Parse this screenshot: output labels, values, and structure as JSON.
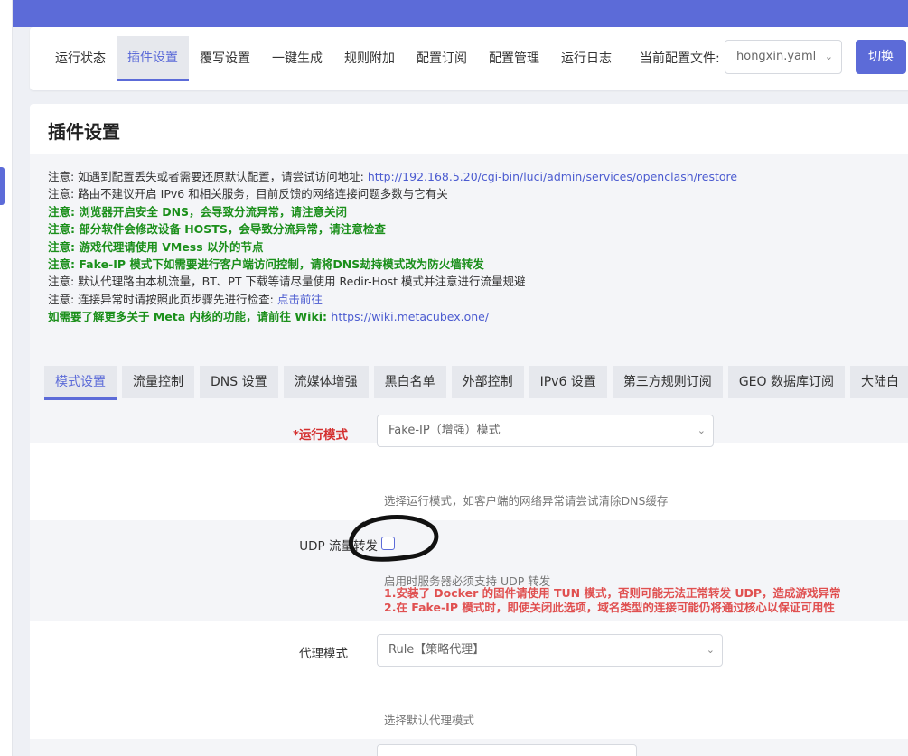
{
  "nav": {
    "tabs": [
      "运行状态",
      "插件设置",
      "覆写设置",
      "一键生成",
      "规则附加",
      "配置订阅",
      "配置管理",
      "运行日志"
    ],
    "active_index": 1,
    "config_label": "当前配置文件:",
    "config_value": "hongxin.yaml",
    "switch_label": "切换"
  },
  "page": {
    "title": "插件设置"
  },
  "notices": [
    {
      "text": "注意: 如遇到配置丢失或者需要还原默认配置，请尝试访问地址: ",
      "link": "http://192.168.5.20/cgi-bin/luci/admin/services/openclash/restore",
      "style": "normal"
    },
    {
      "text": "注意: 路由不建议开启 IPv6 和相关服务，目前反馈的网络连接问题多数与它有关",
      "link": "",
      "style": "normal"
    },
    {
      "text": "注意: 浏览器开启安全 DNS，会导致分流异常，请注意关闭",
      "link": "",
      "style": "green"
    },
    {
      "text": "注意: 部分软件会修改设备 HOSTS，会导致分流异常，请注意检查",
      "link": "",
      "style": "green"
    },
    {
      "text": "注意: 游戏代理请使用 VMess 以外的节点",
      "link": "",
      "style": "green"
    },
    {
      "text": "注意: Fake-IP 模式下如需要进行客户端访问控制，请将DNS劫持模式改为防火墙转发",
      "link": "",
      "style": "green"
    },
    {
      "text": "注意: 默认代理路由本机流量，BT、PT 下载等请尽量使用 Redir-Host 模式并注意进行流量规避",
      "link": "",
      "style": "normal"
    },
    {
      "text": "注意: 连接异常时请按照此页步骤先进行检查: ",
      "link": "点击前往",
      "style": "normal"
    },
    {
      "text": "如需要了解更多关于 Meta 内核的功能，请前往 Wiki: ",
      "link": "https://wiki.metacubex.one/",
      "style": "green"
    }
  ],
  "sub_tabs": [
    "模式设置",
    "流量控制",
    "DNS 设置",
    "流媒体增强",
    "黑白名单",
    "外部控制",
    "IPv6 设置",
    "第三方规则订阅",
    "GEO 数据库订阅",
    "大陆白"
  ],
  "sub_active_index": 0,
  "form": {
    "run_mode": {
      "required_mark": "*",
      "label": "运行模式",
      "value": "Fake-IP（增强）模式",
      "desc": "选择运行模式，如客户端的网络异常请尝试清除DNS缓存"
    },
    "udp": {
      "label": "UDP 流量转发",
      "checked": false,
      "desc": "启用时服务器必须支持 UDP 转发",
      "warning_1": "1.安装了 Docker 的固件请使用 TUN 模式，否则可能无法正常转发 UDP，造成游戏异常",
      "warning_2": "2.在 Fake-IP 模式时，即使关闭此选项，域名类型的连接可能仍将通过核心以保证可用性"
    },
    "proxy_mode": {
      "label": "代理模式",
      "value": "Rule【策略代理】",
      "desc": "选择默认代理模式"
    }
  },
  "colors": {
    "accent": "#5c6bd8",
    "notice_green": "#1a8f1a",
    "warning_red": "#e05050",
    "required_red": "#d43030"
  }
}
